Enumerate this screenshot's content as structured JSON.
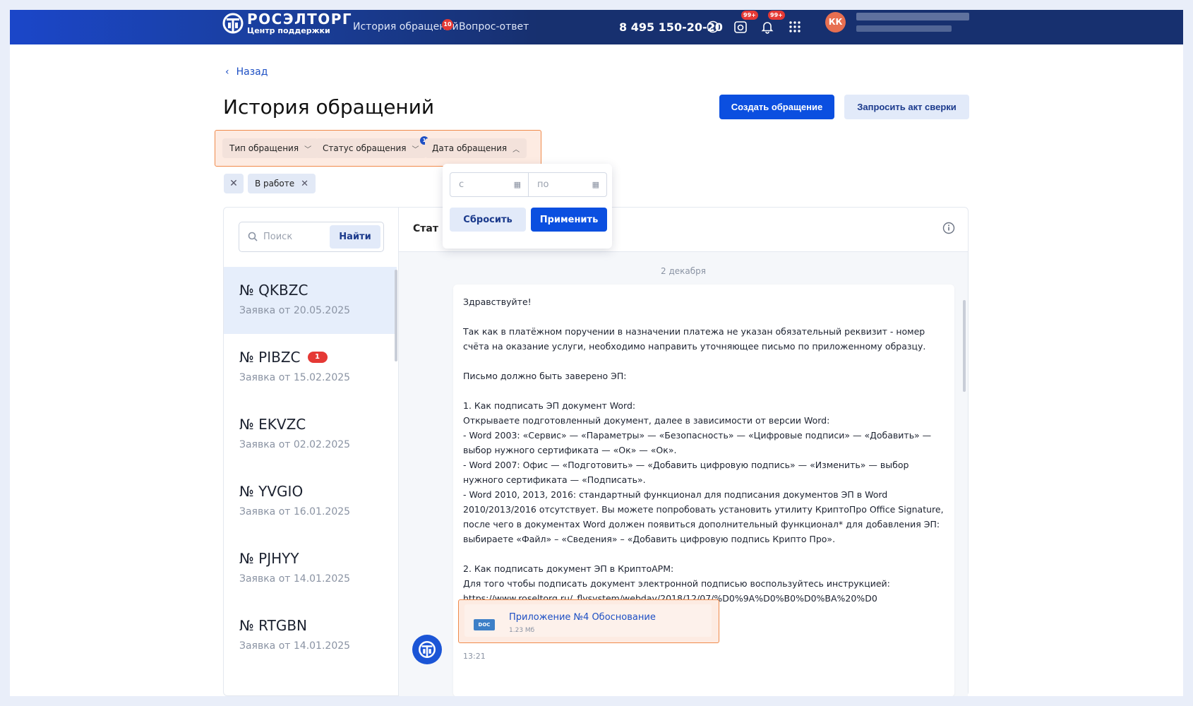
{
  "header": {
    "logo_title": "РОСЭЛТОРГ",
    "logo_subtitle": "Центр поддержки",
    "nav": [
      {
        "label": "История обращений",
        "badge": "10"
      },
      {
        "label": "Вопрос-ответ"
      }
    ],
    "phone": "8 495 150-20-20",
    "icons": [
      {
        "name": "help-icon"
      },
      {
        "name": "card-icon",
        "badge": "99+"
      },
      {
        "name": "bell-icon",
        "badge": "99+"
      },
      {
        "name": "apps-grid-icon"
      }
    ],
    "avatar_initials": "КК"
  },
  "page": {
    "back_label": "Назад",
    "title": "История обращений",
    "create_button": "Создать обращение",
    "reconcile_button": "Запросить акт сверки"
  },
  "filters": {
    "chips": [
      {
        "label": "Тип обращения"
      },
      {
        "label": "Статус обращения",
        "count": "1"
      },
      {
        "label": "Дата обращения"
      }
    ],
    "active_tag": "В работе"
  },
  "date_dropdown": {
    "from_placeholder": "с",
    "to_placeholder": "по",
    "reset_label": "Сбросить",
    "apply_label": "Применить"
  },
  "search": {
    "placeholder": "Поиск",
    "button": "Найти"
  },
  "tickets": [
    {
      "title": "№ QKBZC",
      "subtitle": "Заявка от 20.05.2025",
      "active": true
    },
    {
      "title": "№ PIBZC",
      "subtitle": "Заявка от 15.02.2025",
      "badge": "1"
    },
    {
      "title": "№ EKVZC",
      "subtitle": "Заявка от 02.02.2025"
    },
    {
      "title": "№ YVGIO",
      "subtitle": "Заявка от 16.01.2025"
    },
    {
      "title": "№ PJHYY",
      "subtitle": "Заявка от 14.01.2025"
    },
    {
      "title": "№ RTGBN",
      "subtitle": "Заявка от 14.01.2025"
    }
  ],
  "conversation": {
    "status_label": "Стат",
    "date": "2 декабря",
    "message": "Здравствуйте!\n\nТак как в платёжном поручении в назначении платежа не указан обязательный реквизит - номер счёта на оказание услуги, необходимо направить уточняющее письмо по приложенному образцу.\n\nПисьмо должно быть заверено ЭП:\n\n1. Как подписать ЭП документ Word:\nОткрываете подготовленный документ, далее в зависимости от версии Word:\n- Word 2003: «Сервис» — «Параметры» — «Безопасность» — «Цифровые подписи» — «Добавить» — выбор нужного сертификата — «Ок» — «Ок».\n- Word 2007: Офис — «Подготовить» — «Добавить цифровую подпись» — «Изменить» — выбор нужного сертификата — «Подписать».\n- Word 2010, 2013, 2016: стандартный функционал для подписания документов ЭП в Word 2010/2013/2016 отсутствует. Вы можете попробовать установить утилиту КриптоПро Office Signature, после чего в документах Word должен появиться дополнительный функционал* для добавления ЭП: выбираете «Файл» – «Сведения» – «Добавить цифровую подпись Крипто Про».\n\n2. Как подписать документ ЭП в КриптоАРМ:\nДля того чтобы подписать документ электронной подписью воспользуйтесь инструкцией: https://www.roseltorg.ru/_flysystem/webdav/2018/12/07/%D0%9A%D0%B0%D0%BA%20%D0",
    "attachment": {
      "type": "DOC",
      "name": "Приложение №4 Обоснование",
      "size": "1.23 Мб"
    },
    "time": "13:21"
  },
  "colors": {
    "brand_blue": "#0b4fe0",
    "header_dark": "#17306f",
    "highlight_orange": "#f08a4b",
    "badge_red": "#e53935"
  }
}
